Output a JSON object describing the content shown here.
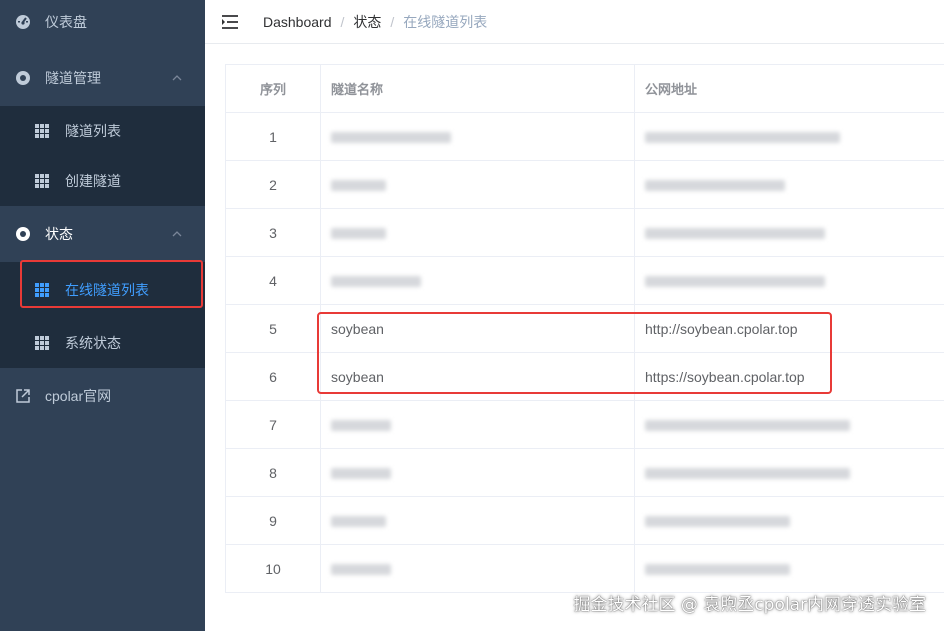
{
  "sidebar": {
    "items": [
      {
        "label": "仪表盘",
        "icon": "dashboard-icon"
      },
      {
        "label": "隧道管理",
        "icon": "tunnel-icon",
        "children": [
          {
            "label": "隧道列表",
            "icon": "table-icon"
          },
          {
            "label": "创建隧道",
            "icon": "table-icon"
          }
        ]
      },
      {
        "label": "状态",
        "icon": "status-icon",
        "children": [
          {
            "label": "在线隧道列表",
            "icon": "table-icon",
            "active": true
          },
          {
            "label": "系统状态",
            "icon": "table-icon"
          }
        ]
      },
      {
        "label": "cpolar官网",
        "icon": "external-link-icon"
      }
    ]
  },
  "breadcrumb": [
    "Dashboard",
    "状态",
    "在线隧道列表"
  ],
  "table": {
    "headers": [
      "序列",
      "隧道名称",
      "公网地址"
    ],
    "rows": [
      {
        "index": "1",
        "name": "",
        "url": ""
      },
      {
        "index": "2",
        "name": "",
        "url": ""
      },
      {
        "index": "3",
        "name": "",
        "url": ""
      },
      {
        "index": "4",
        "name": "",
        "url": ""
      },
      {
        "index": "5",
        "name": "soybean",
        "url": "http://soybean.cpolar.top"
      },
      {
        "index": "6",
        "name": "soybean",
        "url": "https://soybean.cpolar.top"
      },
      {
        "index": "7",
        "name": "",
        "url": ""
      },
      {
        "index": "8",
        "name": "",
        "url": ""
      },
      {
        "index": "9",
        "name": "",
        "url": ""
      },
      {
        "index": "10",
        "name": "",
        "url": ""
      }
    ]
  },
  "watermark": "掘金技术社区 @ 袁煦丞cpolar内网穿透实验室",
  "colors": {
    "sidebar_bg": "#304156",
    "submenu_bg": "#1f2d3d",
    "active": "#409eff",
    "highlight": "#e83a37"
  }
}
